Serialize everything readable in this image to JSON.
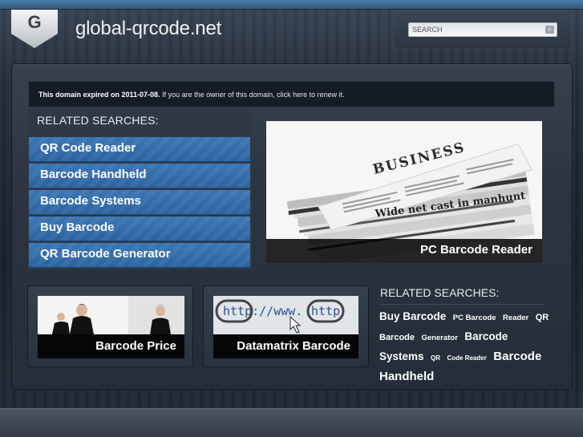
{
  "site": {
    "logo_letter": "G",
    "title": "global-qrcode.net"
  },
  "search": {
    "placeholder": "SEARCH",
    "button_glyph": "⌕"
  },
  "notice": {
    "bold_text": "This domain expired on 2011-07-08.",
    "text": " If you are the owner of this domain, click here to renew it."
  },
  "related": {
    "heading": "RELATED SEARCHES:",
    "links": [
      "QR Code Reader",
      "Barcode Handheld",
      "Barcode Systems",
      "Buy Barcode",
      "QR Barcode Generator"
    ]
  },
  "feature": {
    "caption": "PC Barcode Reader",
    "paper_headlines": [
      "BUSINESS",
      "Wide net cast in manhunt"
    ]
  },
  "thumbs": [
    {
      "caption": "Barcode Price"
    },
    {
      "caption": "Datamatrix Barcode",
      "image_text": [
        "http://www.",
        "http"
      ]
    }
  ],
  "cloud": {
    "heading": "RELATED SEARCHES:",
    "tags": [
      "Buy Barcode",
      "PC Barcode",
      "Reader",
      "QR Barcode",
      "Generator",
      "Barcode Systems",
      "QR",
      "Code Reader",
      "Barcode",
      "Handheld"
    ]
  },
  "colors": {
    "accent_blue": "#3b76b4",
    "topbar_blue": "#4c79a8",
    "background": "#1b2430"
  }
}
